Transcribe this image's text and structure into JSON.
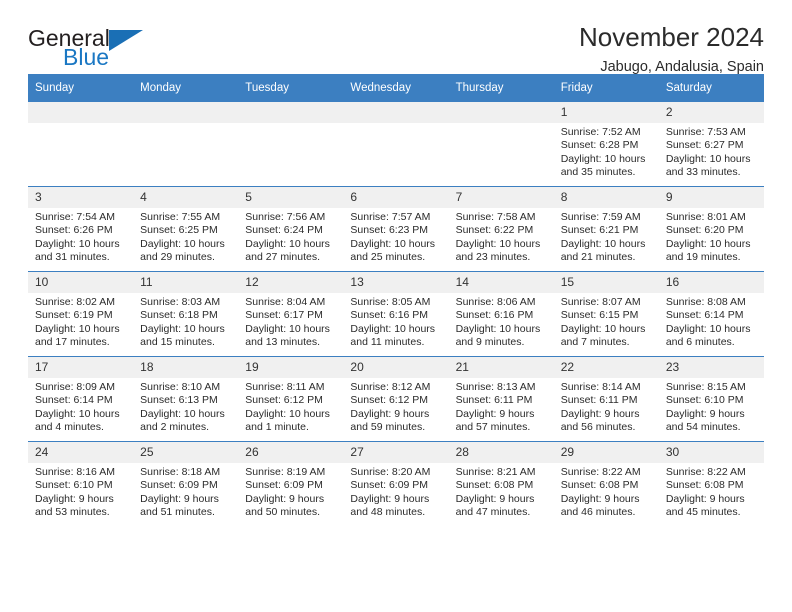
{
  "brand": {
    "line1": "General",
    "line2": "Blue",
    "triangle_color": "#1a6fb5"
  },
  "header": {
    "title": "November 2024",
    "subtitle": "Jabugo, Andalusia, Spain"
  },
  "theme": {
    "header_blue": "#3c7fc1",
    "daynum_bg": "#f0f0f0",
    "text": "#2b2b2b"
  },
  "labels": {
    "sunrise_prefix": "Sunrise:",
    "sunset_prefix": "Sunset:",
    "daylight_prefix": "Daylight:"
  },
  "weekday_headers": [
    "Sunday",
    "Monday",
    "Tuesday",
    "Wednesday",
    "Thursday",
    "Friday",
    "Saturday"
  ],
  "weeks": [
    [
      {
        "day": "",
        "empty": true
      },
      {
        "day": "",
        "empty": true
      },
      {
        "day": "",
        "empty": true
      },
      {
        "day": "",
        "empty": true
      },
      {
        "day": "",
        "empty": true
      },
      {
        "day": "1",
        "sunrise": "Sunrise: 7:52 AM",
        "sunset": "Sunset: 6:28 PM",
        "daylight": "Daylight: 10 hours and 35 minutes."
      },
      {
        "day": "2",
        "sunrise": "Sunrise: 7:53 AM",
        "sunset": "Sunset: 6:27 PM",
        "daylight": "Daylight: 10 hours and 33 minutes."
      }
    ],
    [
      {
        "day": "3",
        "sunrise": "Sunrise: 7:54 AM",
        "sunset": "Sunset: 6:26 PM",
        "daylight": "Daylight: 10 hours and 31 minutes."
      },
      {
        "day": "4",
        "sunrise": "Sunrise: 7:55 AM",
        "sunset": "Sunset: 6:25 PM",
        "daylight": "Daylight: 10 hours and 29 minutes."
      },
      {
        "day": "5",
        "sunrise": "Sunrise: 7:56 AM",
        "sunset": "Sunset: 6:24 PM",
        "daylight": "Daylight: 10 hours and 27 minutes."
      },
      {
        "day": "6",
        "sunrise": "Sunrise: 7:57 AM",
        "sunset": "Sunset: 6:23 PM",
        "daylight": "Daylight: 10 hours and 25 minutes."
      },
      {
        "day": "7",
        "sunrise": "Sunrise: 7:58 AM",
        "sunset": "Sunset: 6:22 PM",
        "daylight": "Daylight: 10 hours and 23 minutes."
      },
      {
        "day": "8",
        "sunrise": "Sunrise: 7:59 AM",
        "sunset": "Sunset: 6:21 PM",
        "daylight": "Daylight: 10 hours and 21 minutes."
      },
      {
        "day": "9",
        "sunrise": "Sunrise: 8:01 AM",
        "sunset": "Sunset: 6:20 PM",
        "daylight": "Daylight: 10 hours and 19 minutes."
      }
    ],
    [
      {
        "day": "10",
        "sunrise": "Sunrise: 8:02 AM",
        "sunset": "Sunset: 6:19 PM",
        "daylight": "Daylight: 10 hours and 17 minutes."
      },
      {
        "day": "11",
        "sunrise": "Sunrise: 8:03 AM",
        "sunset": "Sunset: 6:18 PM",
        "daylight": "Daylight: 10 hours and 15 minutes."
      },
      {
        "day": "12",
        "sunrise": "Sunrise: 8:04 AM",
        "sunset": "Sunset: 6:17 PM",
        "daylight": "Daylight: 10 hours and 13 minutes."
      },
      {
        "day": "13",
        "sunrise": "Sunrise: 8:05 AM",
        "sunset": "Sunset: 6:16 PM",
        "daylight": "Daylight: 10 hours and 11 minutes."
      },
      {
        "day": "14",
        "sunrise": "Sunrise: 8:06 AM",
        "sunset": "Sunset: 6:16 PM",
        "daylight": "Daylight: 10 hours and 9 minutes."
      },
      {
        "day": "15",
        "sunrise": "Sunrise: 8:07 AM",
        "sunset": "Sunset: 6:15 PM",
        "daylight": "Daylight: 10 hours and 7 minutes."
      },
      {
        "day": "16",
        "sunrise": "Sunrise: 8:08 AM",
        "sunset": "Sunset: 6:14 PM",
        "daylight": "Daylight: 10 hours and 6 minutes."
      }
    ],
    [
      {
        "day": "17",
        "sunrise": "Sunrise: 8:09 AM",
        "sunset": "Sunset: 6:14 PM",
        "daylight": "Daylight: 10 hours and 4 minutes."
      },
      {
        "day": "18",
        "sunrise": "Sunrise: 8:10 AM",
        "sunset": "Sunset: 6:13 PM",
        "daylight": "Daylight: 10 hours and 2 minutes."
      },
      {
        "day": "19",
        "sunrise": "Sunrise: 8:11 AM",
        "sunset": "Sunset: 6:12 PM",
        "daylight": "Daylight: 10 hours and 1 minute."
      },
      {
        "day": "20",
        "sunrise": "Sunrise: 8:12 AM",
        "sunset": "Sunset: 6:12 PM",
        "daylight": "Daylight: 9 hours and 59 minutes."
      },
      {
        "day": "21",
        "sunrise": "Sunrise: 8:13 AM",
        "sunset": "Sunset: 6:11 PM",
        "daylight": "Daylight: 9 hours and 57 minutes."
      },
      {
        "day": "22",
        "sunrise": "Sunrise: 8:14 AM",
        "sunset": "Sunset: 6:11 PM",
        "daylight": "Daylight: 9 hours and 56 minutes."
      },
      {
        "day": "23",
        "sunrise": "Sunrise: 8:15 AM",
        "sunset": "Sunset: 6:10 PM",
        "daylight": "Daylight: 9 hours and 54 minutes."
      }
    ],
    [
      {
        "day": "24",
        "sunrise": "Sunrise: 8:16 AM",
        "sunset": "Sunset: 6:10 PM",
        "daylight": "Daylight: 9 hours and 53 minutes."
      },
      {
        "day": "25",
        "sunrise": "Sunrise: 8:18 AM",
        "sunset": "Sunset: 6:09 PM",
        "daylight": "Daylight: 9 hours and 51 minutes."
      },
      {
        "day": "26",
        "sunrise": "Sunrise: 8:19 AM",
        "sunset": "Sunset: 6:09 PM",
        "daylight": "Daylight: 9 hours and 50 minutes."
      },
      {
        "day": "27",
        "sunrise": "Sunrise: 8:20 AM",
        "sunset": "Sunset: 6:09 PM",
        "daylight": "Daylight: 9 hours and 48 minutes."
      },
      {
        "day": "28",
        "sunrise": "Sunrise: 8:21 AM",
        "sunset": "Sunset: 6:08 PM",
        "daylight": "Daylight: 9 hours and 47 minutes."
      },
      {
        "day": "29",
        "sunrise": "Sunrise: 8:22 AM",
        "sunset": "Sunset: 6:08 PM",
        "daylight": "Daylight: 9 hours and 46 minutes."
      },
      {
        "day": "30",
        "sunrise": "Sunrise: 8:22 AM",
        "sunset": "Sunset: 6:08 PM",
        "daylight": "Daylight: 9 hours and 45 minutes."
      }
    ]
  ]
}
